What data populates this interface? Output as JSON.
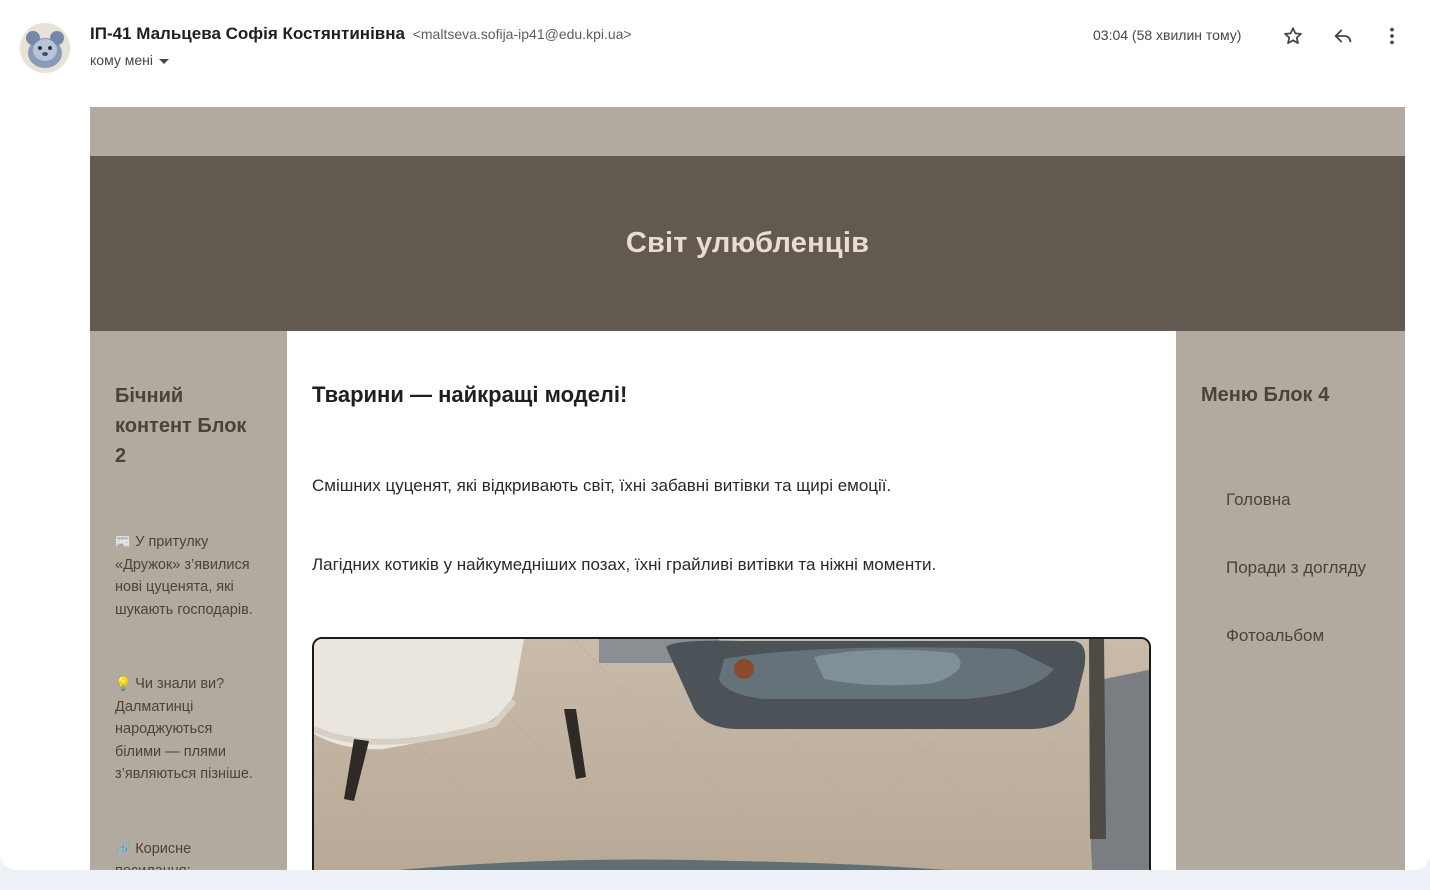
{
  "header": {
    "sender_name": "ІП-41 Мальцева Софія Костянтинівна",
    "sender_email": "<maltseva.sofija-ip41@edu.kpi.ua>",
    "to_label": "кому мені",
    "timestamp": "03:04 (58 хвилин тому)",
    "icons": [
      "avatar",
      "star-icon",
      "reply-icon",
      "more-vert-icon",
      "caret-down-icon"
    ]
  },
  "email": {
    "hero_title": "Світ улюбленців",
    "left": {
      "heading": "Бічний контент Блок 2",
      "notes": [
        {
          "emoji": "📰",
          "text": "У притулку «Дружок» з’явилися нові цуценята, які шукають господарів."
        },
        {
          "emoji": "💡",
          "text": "Чи знали ви? Далматинці народжуються білими — плями з’являються пізніше."
        },
        {
          "emoji": "🔗",
          "text": "Корисне посилання:"
        }
      ]
    },
    "main": {
      "heading": "Тварини — найкращі моделі!",
      "p1": "Смішних цуценят, які відкривають світ, їхні забавні витівки та щирі емоції.",
      "p2": "Лагідних котиків у найкумедніших позах, їхні грайливі витівки та ніжні моменти."
    },
    "right": {
      "heading": "Меню Блок 4",
      "menu": [
        "Головна",
        "Поради з догляду",
        "Фотоальбом"
      ]
    }
  },
  "colors": {
    "hero_bg": "#625a50",
    "side_bg": "#b2aa9f",
    "hero_text": "#e8ddcf",
    "side_text": "#4b4239"
  }
}
